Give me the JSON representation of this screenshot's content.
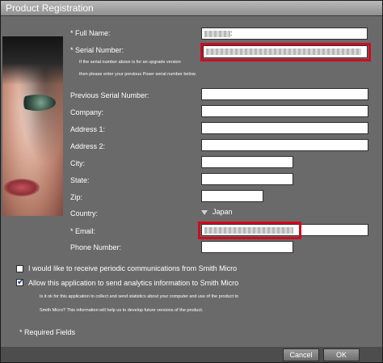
{
  "window": {
    "title": "Product Registration"
  },
  "form": {
    "full_name": {
      "label": "* Full Name:",
      "value": ":"
    },
    "serial_number": {
      "label": "* Serial Number:",
      "hint_line1": "If the serial number above is for an upgrade version",
      "hint_line2": "then please enter your previous Poser serial number below."
    },
    "previous_serial": {
      "label": "Previous Serial Number:"
    },
    "company": {
      "label": "Company:"
    },
    "address1": {
      "label": "Address 1:"
    },
    "address2": {
      "label": "Address 2:"
    },
    "city": {
      "label": "City:"
    },
    "state": {
      "label": "State:"
    },
    "zip": {
      "label": "Zip:"
    },
    "country": {
      "label": "Country:",
      "value": "Japan"
    },
    "email": {
      "label": "* Email:"
    },
    "phone": {
      "label": "Phone Number:"
    }
  },
  "options": {
    "periodic_comms": {
      "label": "I would like to receive periodic communications from Smith Micro",
      "checked": false
    },
    "analytics": {
      "label": "Allow this application to send analytics information to Smith Micro",
      "checked": true,
      "desc_line1": "Is it ok for this application to collect and send statistics about your computer and use of the product to",
      "desc_line2": "Smith Micro?  This information will help us to develop future versions of the product."
    }
  },
  "required_note": "* Required Fields",
  "buttons": {
    "cancel": "Cancel",
    "ok": "OK"
  },
  "colors": {
    "highlight_red": "#d10a1f",
    "panel_gray": "#6a6a6a"
  }
}
